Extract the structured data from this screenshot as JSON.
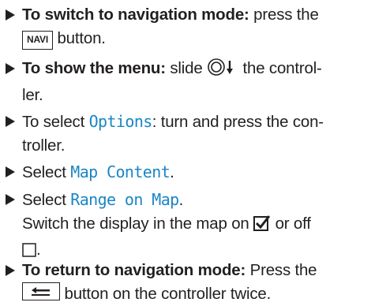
{
  "steps": [
    {
      "lead": "To switch to navigation mode:",
      "text_after_lead": " press the",
      "button_label": "NAVI",
      "text_end": "button."
    },
    {
      "lead": "To show the menu:",
      "text_after_lead": " slide",
      "text_end": "the control-",
      "text_wrap": "ler."
    },
    {
      "text_before": "To select ",
      "menu_term": "Options",
      "text_after": ": turn and press the con-",
      "text_wrap": "troller."
    },
    {
      "text_before": "Select ",
      "menu_term": "Map Content",
      "text_after": "."
    },
    {
      "text_before": "Select ",
      "menu_term": "Range on Map",
      "text_after": ".",
      "line2_before": "Switch the display in the map on",
      "line2_middle": "or off",
      "line3_end": "."
    },
    {
      "lead": "To return to navigation mode:",
      "text_after_lead": " Press the",
      "text_end": "button on the controller twice."
    }
  ],
  "icons": {
    "bullet": "triangle-bullet-icon",
    "controller_slide_down": "controller-slide-down-icon",
    "checked_box": "checked-box-icon",
    "unchecked_box": "unchecked-box-icon",
    "back_button": "back-arrow-icon"
  },
  "colors": {
    "text": "#231f20",
    "menu_term": "#1a86c6"
  }
}
